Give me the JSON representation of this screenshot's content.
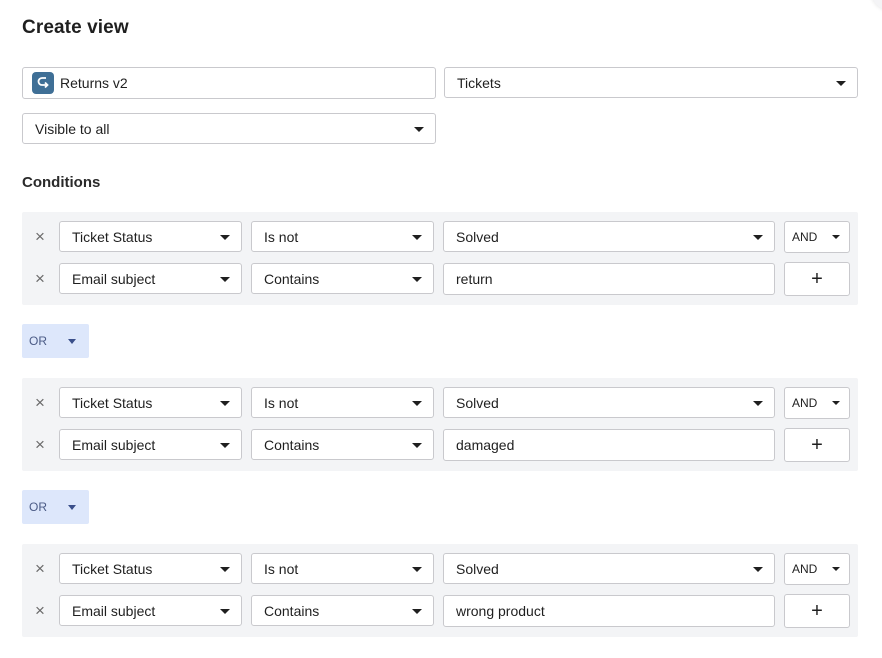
{
  "title": "Create view",
  "view": {
    "name": "Returns v2",
    "name_icon": "return-arrow-icon",
    "object_type": "Tickets",
    "visibility": "Visible to all"
  },
  "conditions_label": "Conditions",
  "groups": [
    {
      "rows": [
        {
          "field": "Ticket Status",
          "operator": "Is not",
          "value": "Solved",
          "value_is_select": true
        },
        {
          "field": "Email subject",
          "operator": "Contains",
          "value": "return",
          "value_is_select": false
        }
      ],
      "join": "AND",
      "add_label": "+"
    },
    {
      "rows": [
        {
          "field": "Ticket Status",
          "operator": "Is not",
          "value": "Solved",
          "value_is_select": true
        },
        {
          "field": "Email subject",
          "operator": "Contains",
          "value": "damaged",
          "value_is_select": false
        }
      ],
      "join": "AND",
      "add_label": "+"
    },
    {
      "rows": [
        {
          "field": "Ticket Status",
          "operator": "Is not",
          "value": "Solved",
          "value_is_select": true
        },
        {
          "field": "Email subject",
          "operator": "Contains",
          "value": "wrong product",
          "value_is_select": false
        }
      ],
      "join": "AND",
      "add_label": "+"
    }
  ],
  "group_connectors": [
    "OR",
    "OR"
  ],
  "remove_icon": "×",
  "colors": {
    "group_bg": "#f3f4f6",
    "or_bg": "#dde7fb",
    "border": "#c9c9cd",
    "icon_bg": "#3f6f96"
  }
}
